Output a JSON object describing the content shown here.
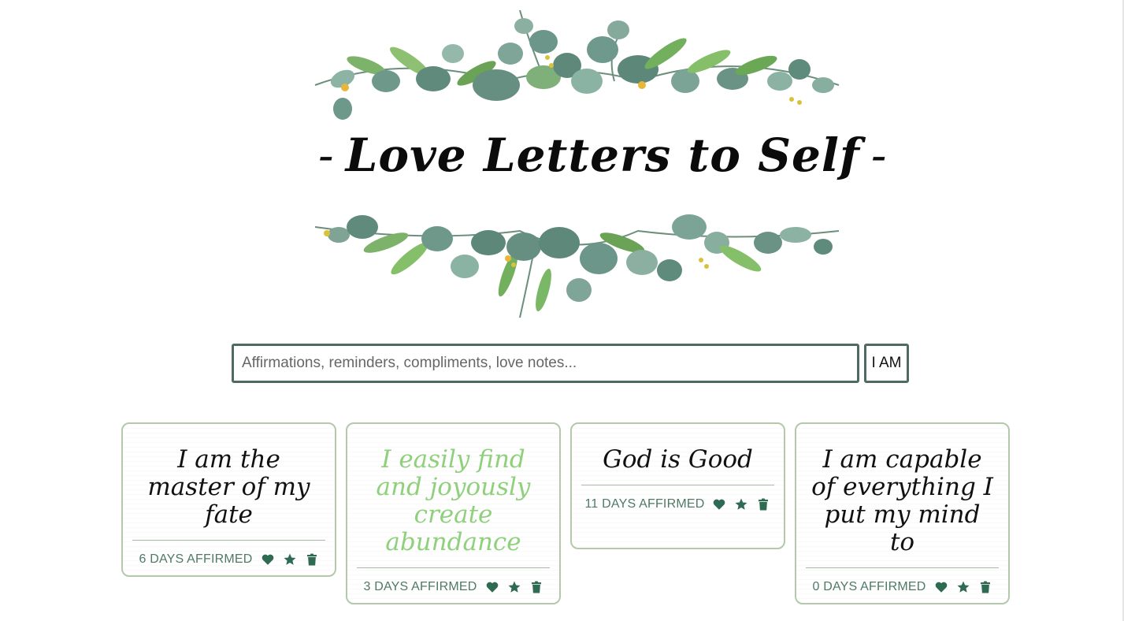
{
  "header": {
    "title": "Love Letters to Self",
    "dash_left": "-",
    "dash_right": "-"
  },
  "input": {
    "placeholder": "Affirmations, reminders, compliments, love notes...",
    "value": "",
    "submit_label": "I AM"
  },
  "cards": [
    {
      "text": "I am the master of my fate",
      "days": "6 DAYS AFFIRMED",
      "highlighted": false
    },
    {
      "text": "I easily find and joyously create abundance",
      "days": "3 DAYS AFFIRMED",
      "highlighted": true
    },
    {
      "text": "God is Good",
      "days": "11 DAYS AFFIRMED",
      "highlighted": false
    },
    {
      "text": "I am capable of everything I put my mind to",
      "days": "0 DAYS AFFIRMED",
      "highlighted": false
    }
  ],
  "icons": {
    "favorite": "heart-icon",
    "star": "star-icon",
    "delete": "trash-icon",
    "decoration": "eucalyptus-leaves"
  },
  "colors": {
    "border": "#4e6a62",
    "card_border": "#b4c8ac",
    "days_text": "#4e7a66",
    "icon": "#2f6a52",
    "highlight_text": "#8fd07c"
  }
}
